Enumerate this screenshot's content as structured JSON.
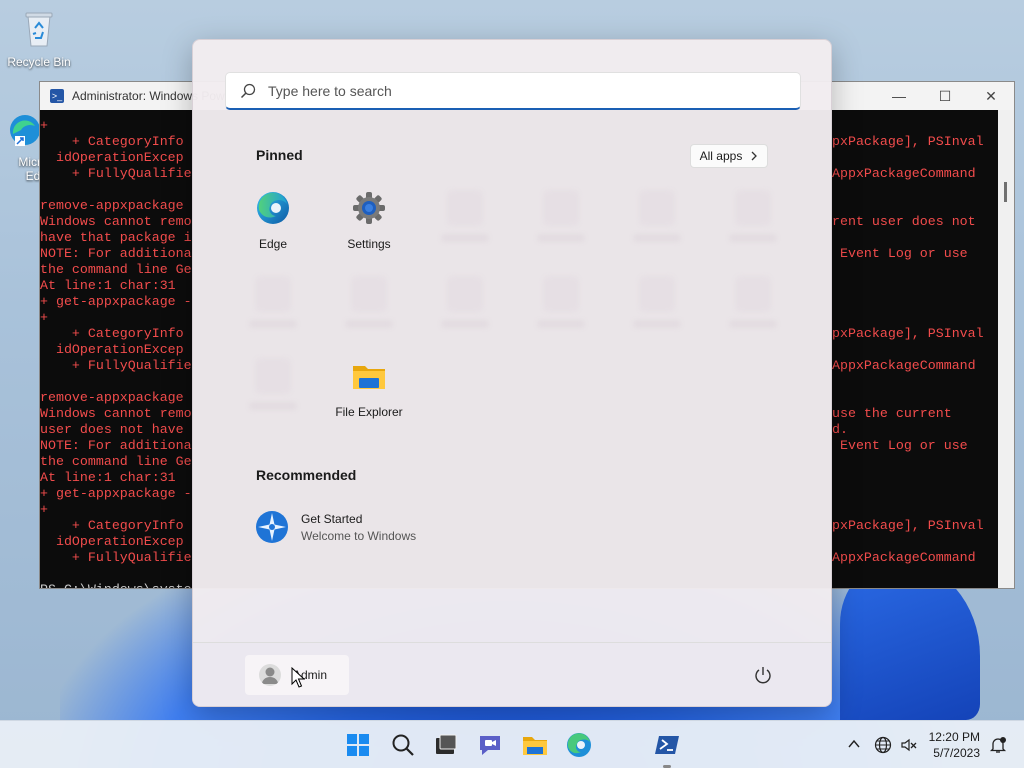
{
  "desktop": {
    "recycle_bin_label": "Recycle Bin",
    "edge_label_line1": "Micro",
    "edge_label_line2": "Ed"
  },
  "powershell": {
    "title": "Administrator: Windows PowerShell",
    "controls": [
      "—",
      "☐",
      "✕"
    ],
    "lines_left": [
      "+",
      "    + CategoryInfo",
      "  idOperationExcep",
      "    + FullyQualifie",
      "",
      "remove-appxpackage",
      "Windows cannot remo",
      "have that package i",
      "NOTE: For additiona",
      "the command line Ge",
      "At line:1 char:31",
      "+ get-appxpackage -",
      "+",
      "    + CategoryInfo",
      "  idOperationExcep",
      "    + FullyQualifie",
      "",
      "remove-appxpackage",
      "Windows cannot remo",
      "user does not have",
      "NOTE: For additiona",
      "the command line Ge",
      "At line:1 char:31",
      "+ get-appxpackage -",
      "+",
      "    + CategoryInfo",
      "  idOperationExcep",
      "    + FullyQualifie",
      "",
      "PS C:\\Windows\\syste"
    ],
    "lines_right": [
      "",
      "pxPackage], PSInval",
      "",
      "AppxPackageCommand",
      "",
      "",
      "rent user does not",
      "",
      " Event Log or use",
      "",
      "",
      "",
      "",
      "pxPackage], PSInval",
      "",
      "AppxPackageCommand",
      "",
      "",
      "use the current",
      "d.",
      " Event Log or use",
      "",
      "",
      "",
      "",
      "pxPackage], PSInval",
      "",
      "AppxPackageCommand",
      "",
      ""
    ]
  },
  "start_menu": {
    "search_placeholder": "Type here to search",
    "pinned_title": "Pinned",
    "all_apps_label": "All apps",
    "pinned": {
      "edge": "Edge",
      "settings": "Settings",
      "file_explorer": "File Explorer"
    },
    "recommended_title": "Recommended",
    "recommended": [
      {
        "title": "Get Started",
        "subtitle": "Welcome to Windows"
      }
    ],
    "user_name": "Admin"
  },
  "taskbar": {
    "time": "12:20 PM",
    "date": "5/7/2023"
  },
  "colors": {
    "accent": "#1a5fb4",
    "ps_error_text": "#f24c4c",
    "ps_background": "#0c0c0c"
  }
}
